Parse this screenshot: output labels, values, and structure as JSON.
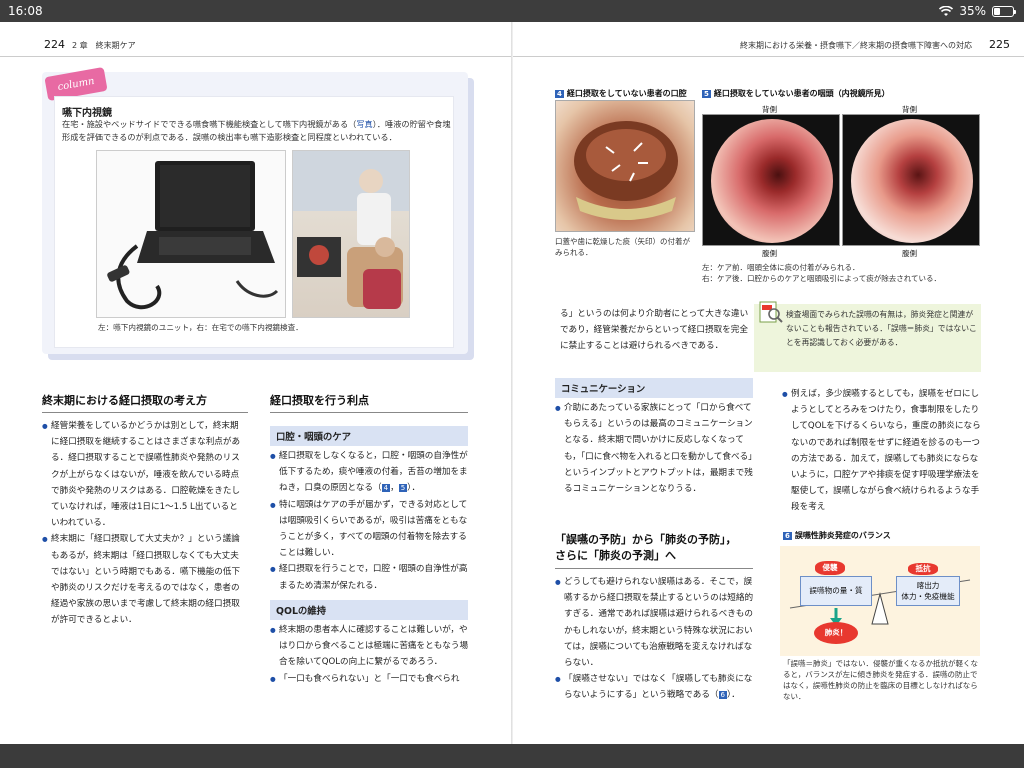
{
  "status_bar": {
    "time": "16:08",
    "battery": "35%"
  },
  "left_page": {
    "page_number": "224",
    "running_head": "2 章　終末期ケア",
    "column": {
      "tag": "column",
      "title": "嚥下内視鏡",
      "text_pre": "在宅・施設やベッドサイドでできる嚥食嚥下機能検査として嚥下内視鏡がある（",
      "text_link": "写真",
      "text_post": "）．唾液の貯留や食塊形成を評価できるのが利点である．誤嚥の検出率も嚥下造影検査と同程度といわれている．",
      "caption": "左：嚥下内視鏡のユニット，右：在宅での嚥下内視鏡検査．"
    },
    "section1": {
      "title": "終末期における経口摂取の考え方",
      "bullet1": "経管栄養をしているかどうかは別として，終末期に経口摂取を継続することはさまざまな利点がある．経口摂取することで誤嚥性肺炎や発熱のリスクが上がらなくはないが，唾液を飲んでいる時点で肺炎や発熱のリスクはある．口腔乾燥をきたしていなければ，唾液は1日に1〜1.5 L出ているといわれている．",
      "bullet2": "終末期に「経口摂取して大丈夫か？」という議論もあるが，終末期は「経口摂取しなくても大丈夫ではない」という時期でもある．嚥下機能の低下や肺炎のリスクだけを考えるのではなく，患者の経過や家族の思いまで考慮して終末期の経口摂取が許可できるとよい．"
    },
    "section2": {
      "title": "経口摂取を行う利点",
      "sub1": "口腔・咽頭のケア",
      "bullet1_pre": "経口摂取をしなくなると，口腔・咽頭の自浄性が低下するため，痰や唾液の付着，舌苔の増加をまねき，口臭の原因となる（",
      "ref4": "4",
      "ref5": "5",
      "bullet1_post": "）．",
      "bullet2": "特に咽頭はケアの手が届かず，できる対応としては咽頭吸引くらいであるが，吸引は苦痛をともなうことが多く，すべての咽頭の付着物を除去することは難しい．",
      "bullet3": "経口摂取を行うことで，口腔・咽頭の自浄性が高まるため清潔が保たれる．",
      "sub2": "QOLの維持",
      "bullet4": "終末期の患者本人に確認することは難しいが，やはり口から食べることは極端に苦痛をともなう場合を除いてQOLの向上に繋がるであろう．",
      "bullet5": "「一口も食べられない」と「一口でも食べられ"
    }
  },
  "right_page": {
    "page_number": "225",
    "running_head": "終末期における栄養・摂食嚥下／終末期の摂食嚥下障害への対応",
    "fig4": {
      "no": "4",
      "title": "経口摂取をしていない患者の口腔",
      "caption": "口蓋や歯に乾燥した痰（矢印）の付着がみられる．"
    },
    "fig5": {
      "no": "5",
      "title": "経口摂取をしていない患者の咽頭（内視鏡所見）",
      "label_back_left": "背側",
      "label_back_right": "背側",
      "label_ventral_left": "腹側",
      "label_ventral_right": "腹側",
      "caption1": "左：ケア前．咽頭全体に痰の付着がみられる．",
      "caption2": "右：ケア後．口腔からのケアと咽頭吸引によって痰が除去されている．"
    },
    "para_top": "る」というのは何より介助者にとって大きな違いであり，経管栄養だからといって経口摂取を完全に禁止することは避けられるべきである．",
    "communication": {
      "title": "コミュニケーション",
      "bullet": "介助にあたっている家族にとって「口から食べてもらえる」というのは最高のコミュニケーションとなる．終末期で問いかけに反応しなくなっても，「口に食べ物を入れると口を動かして食べる」というインプットとアウトプットは，最期まで残るコミュニケーションとなりうる．"
    },
    "section3": {
      "title_line1": "「誤嚥の予防」から「肺炎の予防」，",
      "title_line2": "さらに「肺炎の予測」へ",
      "bullet1": "どうしても避けられない誤嚥はある．そこで，誤嚥するから経口摂取を禁止するというのは短絡的すぎる．通常であれば誤嚥は避けられるべきものかもしれないが，終末期という特殊な状況においては，誤嚥についても治療戦略を変えなければならない．",
      "bullet2_pre": "「誤嚥させない」ではなく「誤嚥しても肺炎にならないようにする」という戦略である（",
      "ref6": "6",
      "bullet2_post": "）．"
    },
    "note": {
      "text": "検査場面でみられた誤嚥の有無は，肺炎発症と関連がないことも報告されている．「誤嚥＝肺炎」ではないことを再認識しておく必要がある．"
    },
    "col3_text": "例えば，多少誤嚥するとしても，誤嚥をゼロにしようとしてとろみをつけたり，食事制限をしたりしてQOLを下げるくらいなら，重度の肺炎にならないのであれば制限をせずに経過を診るのも一つの方法である．加えて，誤嚥しても肺炎にならないように，口腔ケアや排痰を促す呼吸理学療法を駆使して，誤嚥しながら食べ続けられるような手段を考え",
    "fig6": {
      "no": "6",
      "title": "誤嚥性肺炎発症のバランス",
      "node_invade": "侵襲",
      "node_amount": "誤嚥物の量・質",
      "node_resist": "抵抗",
      "node_defense_line1": "喀出力",
      "node_defense_line2": "体力・免疫機能",
      "node_pneumonia": "肺炎！",
      "caption": "「誤嚥＝肺炎」ではない．侵襲が重くなるか抵抗が軽くなると，バランスが左に傾き肺炎を発症する．誤嚥の防止ではなく，誤嚥性肺炎の防止を臨床の目標としなければならない．"
    }
  },
  "colors": {
    "accent_blue": "#2f63b8",
    "heading_band": "#d9e2f3",
    "column_pink": "#e86aa3",
    "note_green": "#eef5dc"
  },
  "icons": {
    "wifi": "wifi-icon",
    "battery": "battery-icon",
    "note": "magnifier-note-icon"
  },
  "battery_level": 0.35
}
